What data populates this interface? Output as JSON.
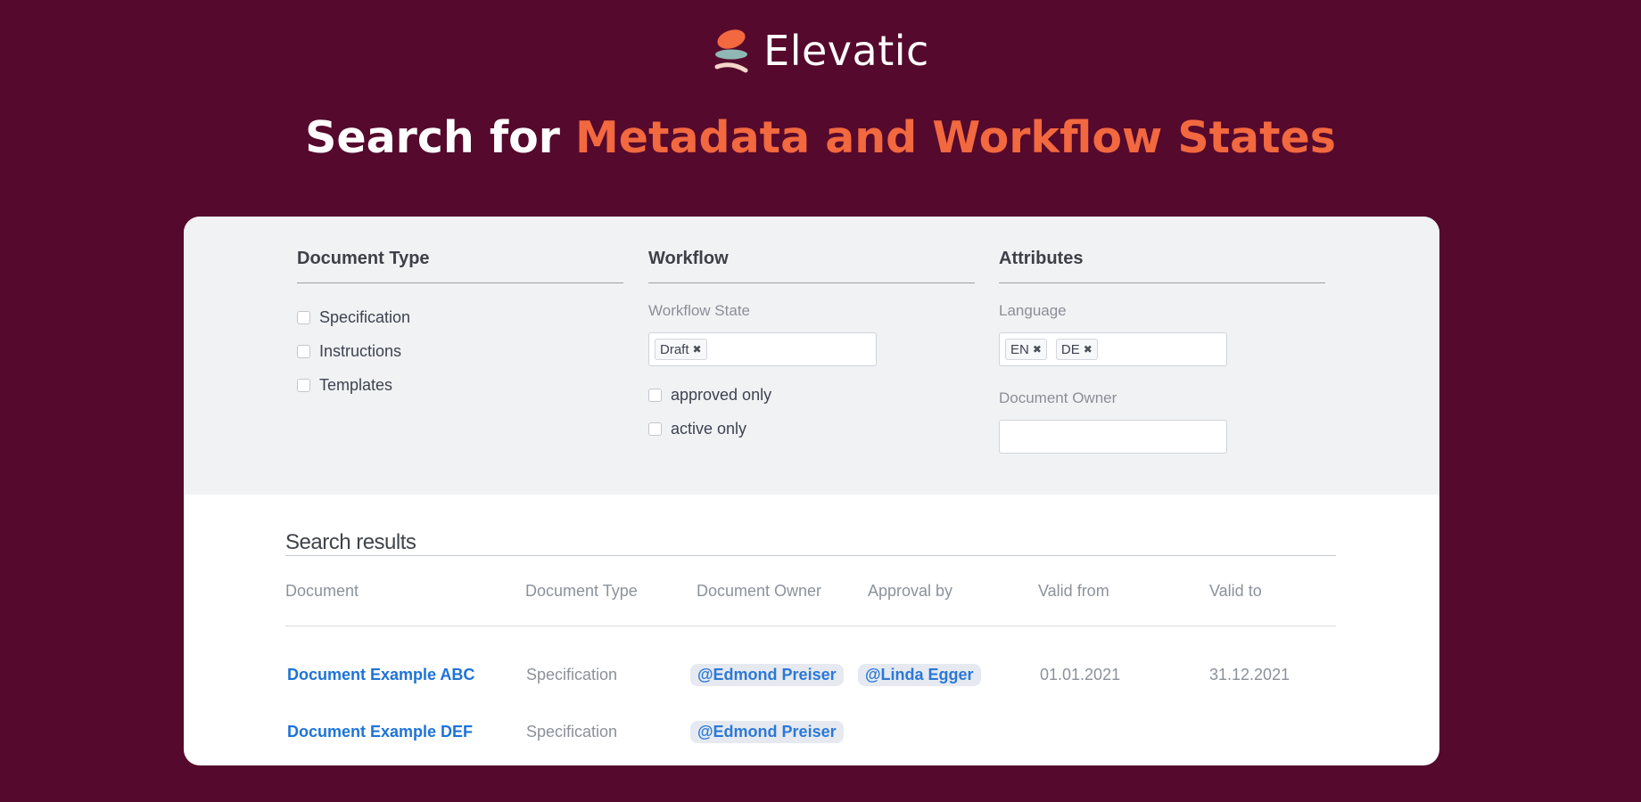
{
  "brand": {
    "name": "Elevatic"
  },
  "headline": {
    "prefix": "Search for",
    "accent": "Metadata and Workflow States"
  },
  "colors": {
    "background": "#55092c",
    "accent": "#f2683f",
    "link": "#1d73d8"
  },
  "filters": {
    "document_type": {
      "title": "Document Type",
      "options": [
        "Specification",
        "Instructions",
        "Templates"
      ]
    },
    "workflow": {
      "title": "Workflow",
      "state_label": "Workflow State",
      "state_tags": [
        "Draft"
      ],
      "checkboxes": [
        "approved only",
        "active only"
      ]
    },
    "attributes": {
      "title": "Attributes",
      "language_label": "Language",
      "language_tags": [
        "EN",
        "DE"
      ],
      "owner_label": "Document Owner",
      "owner_value": ""
    }
  },
  "results": {
    "title": "Search results",
    "columns": [
      "Document",
      "Document Type",
      "Document Owner",
      "Approval by",
      "Valid from",
      "Valid to"
    ],
    "rows": [
      {
        "document": "Document Example ABC",
        "type": "Specification",
        "owner": "@Edmond Preiser",
        "approval": "@Linda Egger",
        "valid_from": "01.01.2021",
        "valid_to": "31.12.2021"
      },
      {
        "document": "Document Example DEF",
        "type": "Specification",
        "owner": "@Edmond Preiser",
        "approval": "",
        "valid_from": "",
        "valid_to": ""
      }
    ]
  }
}
